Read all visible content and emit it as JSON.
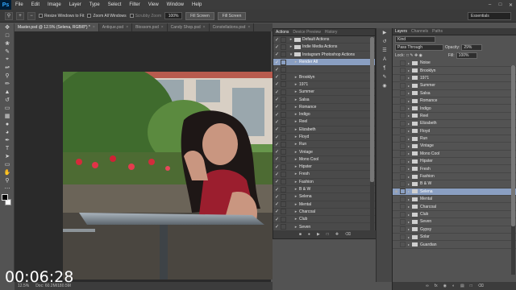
{
  "app_logo": "Ps",
  "menu": [
    "File",
    "Edit",
    "Image",
    "Layer",
    "Type",
    "Select",
    "Filter",
    "View",
    "Window",
    "Help"
  ],
  "window_controls": [
    "minimize-icon",
    "maximize-icon",
    "close-icon"
  ],
  "options": {
    "resize_windows": "Resize Windows to Fit",
    "zoom_all": "Zoom All Windows",
    "scrubby_zoom": "Scrubby Zoom",
    "zoom_value": "100%",
    "fill_screen_1": "Fill Screen",
    "fill_screen_2": "Fill Screen",
    "workspace": "Essentials"
  },
  "tabs": [
    {
      "label": "Master.psd @ 12.5% (Selena, RGB/8*) *",
      "active": true
    },
    {
      "label": "Antique.psd",
      "active": false
    },
    {
      "label": "Blossom.psd",
      "active": false
    },
    {
      "label": "Candy Shop.psd",
      "active": false
    },
    {
      "label": "Constellations.psd",
      "active": false
    }
  ],
  "status": {
    "zoom": "12.5%",
    "doc": "Doc: 60.2M/180.5M"
  },
  "timer": "00:06:28",
  "actions_panel": {
    "tabs": [
      "Actions",
      "Device Preview",
      "History"
    ],
    "rows": [
      {
        "label": "Default Actions",
        "type": "set"
      },
      {
        "label": "Indie Media Actions",
        "type": "set"
      },
      {
        "label": "Instagram Photoshop Actions",
        "type": "set"
      },
      {
        "label": "Render All",
        "type": "action",
        "selected": true
      },
      {
        "label": "",
        "type": "blank"
      },
      {
        "label": "Brooklyn",
        "type": "action"
      },
      {
        "label": "1971",
        "type": "action"
      },
      {
        "label": "Summer",
        "type": "action"
      },
      {
        "label": "Salsa",
        "type": "action"
      },
      {
        "label": "Romance",
        "type": "action"
      },
      {
        "label": "Indigo",
        "type": "action"
      },
      {
        "label": "Reel",
        "type": "action"
      },
      {
        "label": "Elizabeth",
        "type": "action"
      },
      {
        "label": "Floyd",
        "type": "action"
      },
      {
        "label": "Run",
        "type": "action"
      },
      {
        "label": "Vintage",
        "type": "action"
      },
      {
        "label": "Mono Cool",
        "type": "action"
      },
      {
        "label": "Hipster",
        "type": "action"
      },
      {
        "label": "Fresh",
        "type": "action"
      },
      {
        "label": "Fashion",
        "type": "action"
      },
      {
        "label": "B & W",
        "type": "action"
      },
      {
        "label": "Selena",
        "type": "action"
      },
      {
        "label": "Mental",
        "type": "action"
      },
      {
        "label": "Charcoal",
        "type": "action"
      },
      {
        "label": "Club",
        "type": "action"
      },
      {
        "label": "Seven",
        "type": "action"
      }
    ]
  },
  "layers_panel": {
    "tabs": [
      "Layers",
      "Channels",
      "Paths"
    ],
    "kind": "Kind",
    "blend_mode": "Pass Through",
    "opacity_label": "Opacity:",
    "opacity": "29%",
    "lock_label": "Lock:",
    "fill_label": "Fill:",
    "fill": "100%",
    "layers": [
      {
        "name": "Noise",
        "visible": false
      },
      {
        "name": "Brooklyn",
        "visible": false
      },
      {
        "name": "1971",
        "visible": false
      },
      {
        "name": "Summer",
        "visible": false
      },
      {
        "name": "Salsa",
        "visible": false
      },
      {
        "name": "Romance",
        "visible": false
      },
      {
        "name": "Indigo",
        "visible": false
      },
      {
        "name": "Reel",
        "visible": false
      },
      {
        "name": "Elizabeth",
        "visible": false
      },
      {
        "name": "Floyd",
        "visible": false
      },
      {
        "name": "Run",
        "visible": false
      },
      {
        "name": "Vintage",
        "visible": false
      },
      {
        "name": "Mono Cool",
        "visible": false
      },
      {
        "name": "Hipster",
        "visible": false
      },
      {
        "name": "Fresh",
        "visible": false
      },
      {
        "name": "Fashion",
        "visible": false
      },
      {
        "name": "B & W",
        "visible": false
      },
      {
        "name": "Selena",
        "visible": true,
        "selected": true
      },
      {
        "name": "Mental",
        "visible": false
      },
      {
        "name": "Charcoal",
        "visible": false
      },
      {
        "name": "Club",
        "visible": false
      },
      {
        "name": "Seven",
        "visible": false
      },
      {
        "name": "Gypsy",
        "visible": false
      },
      {
        "name": "Solar",
        "visible": false
      },
      {
        "name": "Guardian",
        "visible": false
      }
    ]
  },
  "colors": {
    "selection": "#8a9fc2",
    "ps_blue": "#31a8ff"
  }
}
